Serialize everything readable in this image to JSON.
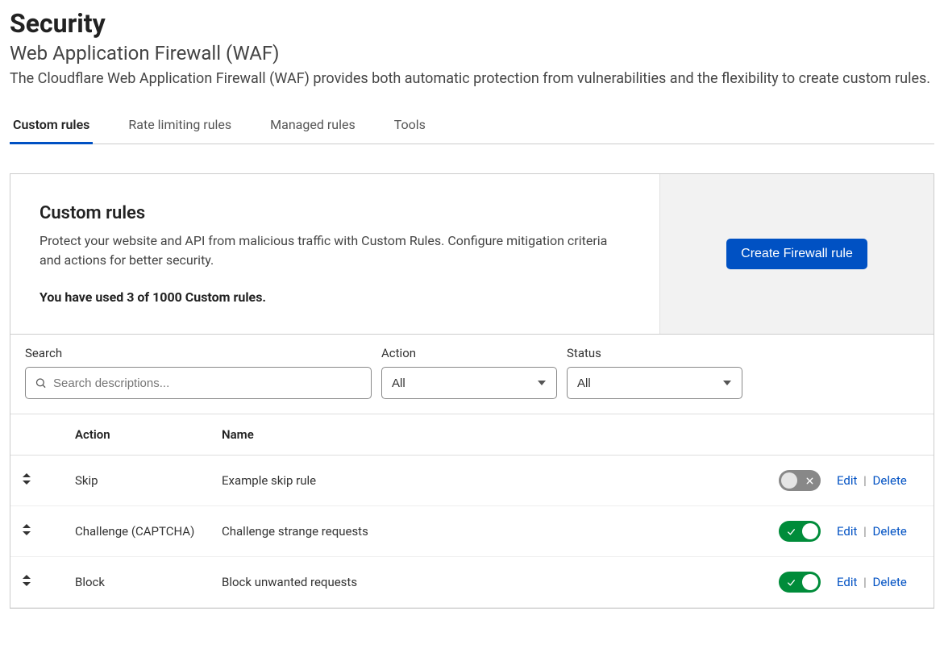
{
  "header": {
    "title": "Security",
    "subtitle": "Web Application Firewall (WAF)",
    "description": "The Cloudflare Web Application Firewall (WAF) provides both automatic protection from vulnerabilities and the flexibility to create custom rules."
  },
  "tabs": [
    {
      "label": "Custom rules",
      "active": true
    },
    {
      "label": "Rate limiting rules",
      "active": false
    },
    {
      "label": "Managed rules",
      "active": false
    },
    {
      "label": "Tools",
      "active": false
    }
  ],
  "card": {
    "title": "Custom rules",
    "description": "Protect your website and API from malicious traffic with Custom Rules. Configure mitigation criteria and actions for better security.",
    "usage": "You have used 3 of 1000 Custom rules.",
    "create_button": "Create Firewall rule"
  },
  "filters": {
    "search": {
      "label": "Search",
      "placeholder": "Search descriptions..."
    },
    "action": {
      "label": "Action",
      "value": "All"
    },
    "status": {
      "label": "Status",
      "value": "All"
    }
  },
  "table": {
    "columns": {
      "action": "Action",
      "name": "Name"
    },
    "row_actions": {
      "edit": "Edit",
      "delete": "Delete"
    },
    "rows": [
      {
        "action": "Skip",
        "name": "Example skip rule",
        "enabled": false
      },
      {
        "action": "Challenge (CAPTCHA)",
        "name": "Challenge strange requests",
        "enabled": true
      },
      {
        "action": "Block",
        "name": "Block unwanted requests",
        "enabled": true
      }
    ]
  }
}
